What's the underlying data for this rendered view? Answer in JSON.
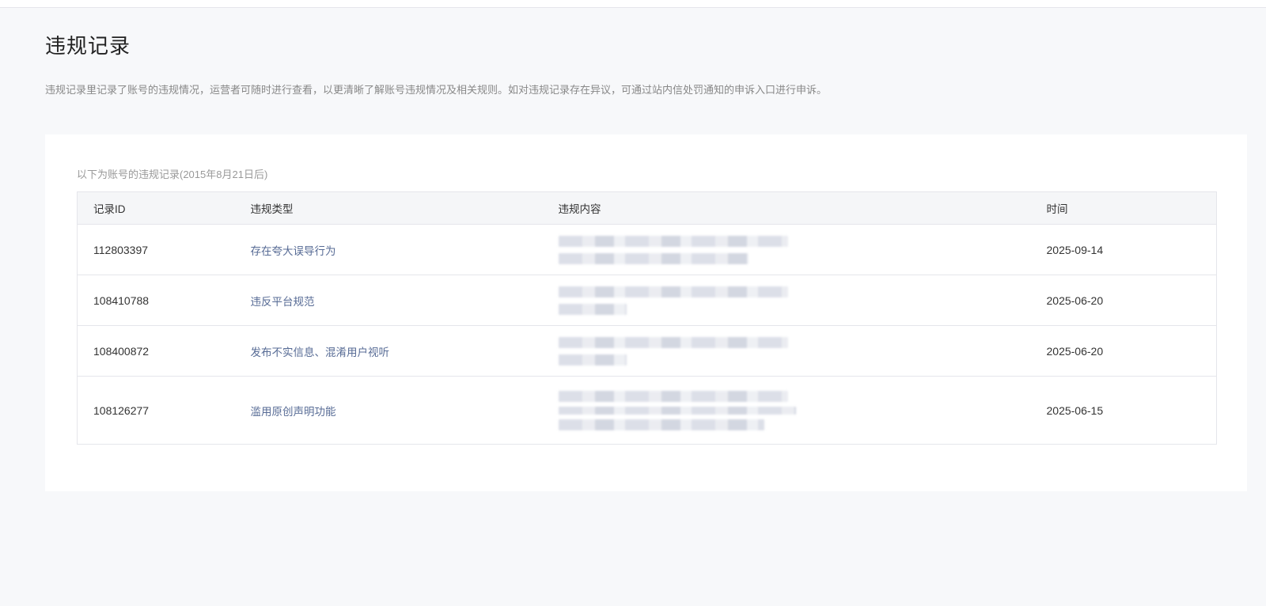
{
  "page": {
    "title": "违规记录",
    "description": "违规记录里记录了账号的违规情况，运营者可随时进行查看，以更清晰了解账号违规情况及相关规则。如对违规记录存在异议，可通过站内信处罚通知的申诉入口进行申诉。"
  },
  "card": {
    "note": "以下为账号的违规记录(2015年8月21日后)"
  },
  "table": {
    "columns": [
      "记录ID",
      "违规类型",
      "违规内容",
      "时间"
    ],
    "rows": [
      {
        "id": "112803397",
        "type": "存在夸大误导行为",
        "time": "2025-09-14"
      },
      {
        "id": "108410788",
        "type": "违反平台规范",
        "time": "2025-06-20"
      },
      {
        "id": "108400872",
        "type": "发布不实信息、混淆用户视听",
        "time": "2025-06-20"
      },
      {
        "id": "108126277",
        "type": "滥用原创声明功能",
        "time": "2025-06-15"
      }
    ]
  },
  "colors": {
    "background": "#f7f8fa",
    "card": "#ffffff",
    "link": "#576b95",
    "header_row": "#f5f6f8",
    "border": "#e5e6eb"
  }
}
